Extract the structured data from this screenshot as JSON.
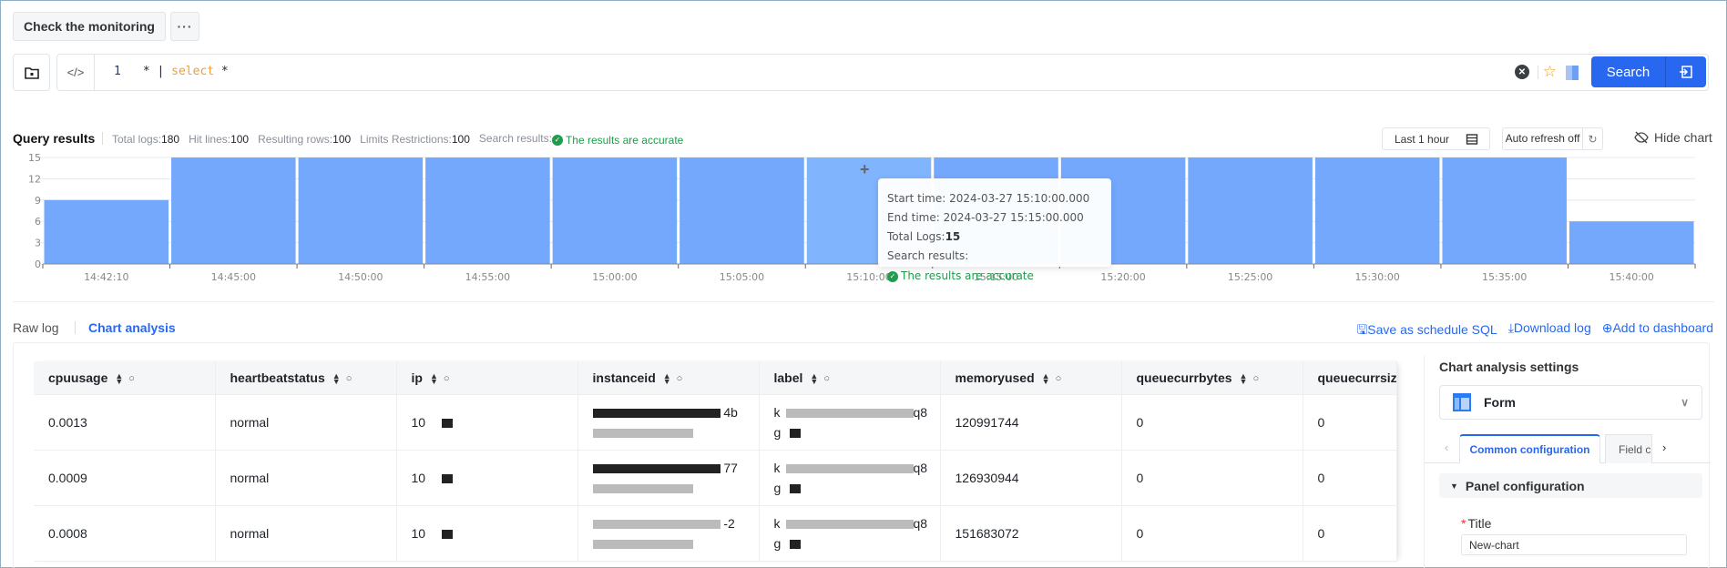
{
  "top": {
    "query_tab_label": "Check the monitoring",
    "more_label": "···"
  },
  "query": {
    "line_number": "1",
    "code_prefix": "* | ",
    "code_keyword": "select",
    "code_suffix": " *",
    "search_label": "Search"
  },
  "results": {
    "title": "Query results",
    "stats": [
      {
        "label": "Total logs:",
        "value": "180"
      },
      {
        "label": "Hit lines:",
        "value": "100"
      },
      {
        "label": "Resulting rows:",
        "value": "100"
      },
      {
        "label": "Limits Restrictions:",
        "value": "100"
      }
    ],
    "search_results_label": "Search results:",
    "accuracy_text": "The results are accurate",
    "time_range_label": "Last 1 hour",
    "auto_refresh_label": "Auto refresh off",
    "hide_chart_label": "Hide chart"
  },
  "chart_data": {
    "type": "bar",
    "categories": [
      "14:42:10",
      "14:45:00",
      "14:50:00",
      "14:55:00",
      "15:00:00",
      "15:05:00",
      "15:10:00",
      "15:15:00",
      "15:20:00",
      "15:25:00",
      "15:30:00",
      "15:35:00",
      "15:40:00"
    ],
    "values": [
      9,
      15,
      15,
      15,
      15,
      15,
      15,
      15,
      15,
      15,
      15,
      15,
      6
    ],
    "highlighted_index": 6,
    "yticks": [
      0,
      3,
      6,
      9,
      12,
      15
    ],
    "ylim": [
      0,
      15
    ],
    "title": "",
    "xlabel": "",
    "ylabel": "",
    "grid": true,
    "bar_color": "#74a8fc",
    "highlight_color": "#80b4fd"
  },
  "tooltip": {
    "start_label": "Start time: ",
    "start_value": "2024-03-27 15:10:00.000",
    "end_label": "End time: ",
    "end_value": "2024-03-27 15:15:00.000",
    "total_label": "Total Logs:",
    "total_value": "15",
    "search_label": "Search results:",
    "accuracy_text": "The results are accurate"
  },
  "modes": {
    "raw_log": "Raw log",
    "chart_analysis": "Chart analysis"
  },
  "actions": {
    "save_schedule": "Save as schedule SQL",
    "download_log": "Download log",
    "add_dashboard": "Add to dashboard"
  },
  "table": {
    "columns": [
      "cpuusage",
      "heartbeatstatus",
      "ip",
      "instanceid",
      "label",
      "memoryused",
      "queuecurrbytes",
      "queuecurrsiz"
    ],
    "rows": [
      {
        "cpuusage": "0.0013",
        "heartbeatstatus": "normal",
        "ip": "10",
        "instanceid_end": "4b",
        "label_start": "k",
        "label_end": "q8",
        "label_line2": "g",
        "memoryused": "120991744",
        "queuecurrbytes": "0",
        "queuecurrsize": "0"
      },
      {
        "cpuusage": "0.0009",
        "heartbeatstatus": "normal",
        "ip": "10",
        "instanceid_end": "77",
        "label_start": "k",
        "label_end": "q8",
        "label_line2": "g",
        "memoryused": "126930944",
        "queuecurrbytes": "0",
        "queuecurrsize": "0"
      },
      {
        "cpuusage": "0.0008",
        "heartbeatstatus": "normal",
        "ip": "10",
        "instanceid_end": "-2",
        "label_start": "k",
        "label_end": "q8",
        "label_line2": "g",
        "memoryused": "151683072",
        "queuecurrbytes": "0",
        "queuecurrsize": "0"
      }
    ]
  },
  "settings": {
    "title": "Chart analysis settings",
    "chart_type": "Form",
    "tabs": [
      "Common configuration",
      "Field c"
    ],
    "section": "Panel configuration",
    "title_field_label": "Title",
    "title_field_value": "New-chart"
  }
}
